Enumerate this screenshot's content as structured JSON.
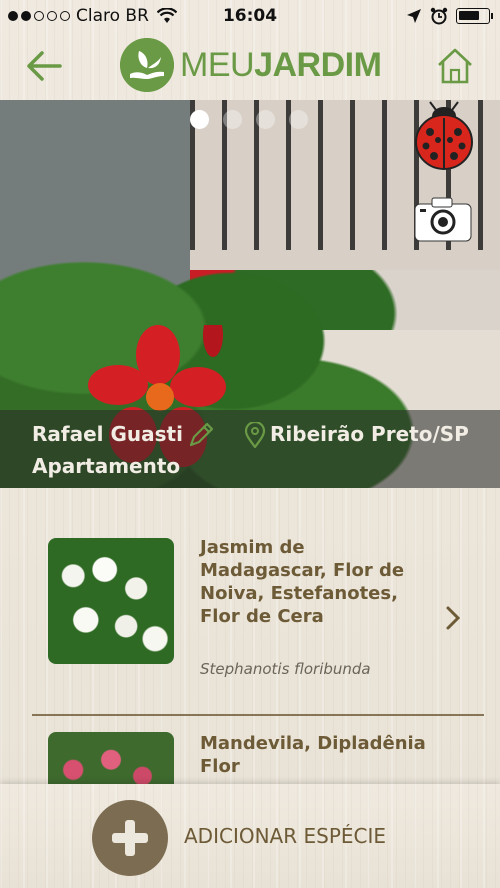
{
  "status_bar": {
    "carrier": "Claro BR",
    "time": "16:04"
  },
  "header": {
    "logo_meu": "MEU",
    "logo_jardim": "JARDIM",
    "back_icon": "arrow-left-icon",
    "home_icon": "home-icon"
  },
  "hero": {
    "owner": "Rafael Guasti",
    "location": "Ribeirão Preto/SP",
    "garden_type": "Apartamento",
    "page_count": 4,
    "active_page": 1
  },
  "species": [
    {
      "name": "Jasmim de Madagascar, Flor de Noiva, Estefanotes, Flor de Cera",
      "scientific": "Stephanotis floribunda"
    },
    {
      "name": "Mandevila, Dipladênia Flor",
      "scientific": ""
    }
  ],
  "actions": {
    "add_species": "ADICIONAR ESPÉCIE"
  },
  "colors": {
    "brand_green": "#6a9a45",
    "text_brown": "#6d5a36",
    "button_brown": "#7c6c52"
  }
}
